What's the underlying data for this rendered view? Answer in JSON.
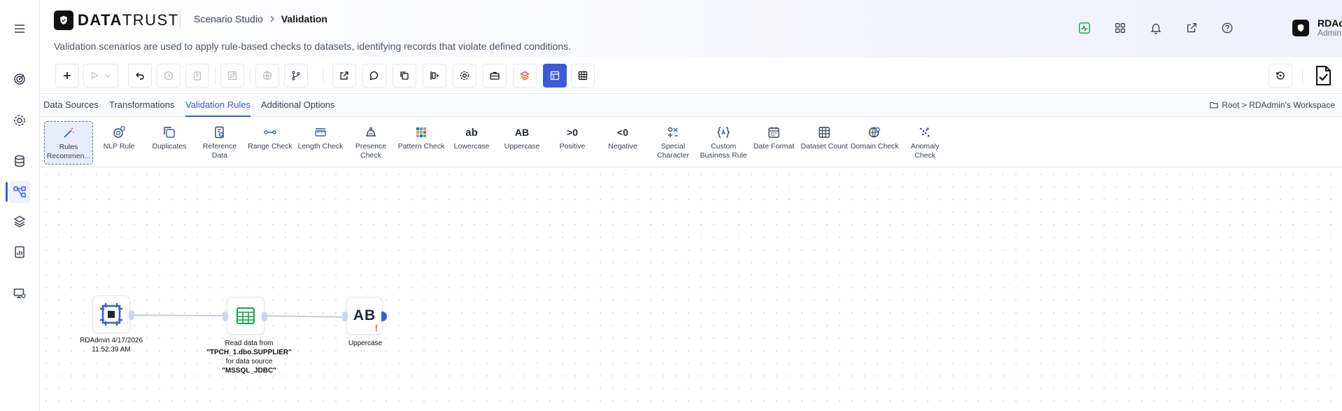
{
  "app": {
    "brand_prefix": "DATA",
    "brand_suffix": "TRUST",
    "breadcrumb": [
      "Scenario Studio",
      "Validation"
    ],
    "description": "Validation scenarios are used to apply rule-based checks to datasets, identifying records that violate defined conditions.",
    "accent_color": "#3b5bdb"
  },
  "user": {
    "name": "RDAdmin",
    "role": "Admin"
  },
  "tabs": [
    {
      "label": "Data Sources"
    },
    {
      "label": "Transformations"
    },
    {
      "label": "Validation Rules",
      "active": true
    },
    {
      "label": "Additional Options"
    }
  ],
  "workspace_path": "Root > RDAdmin's Workspace",
  "palette": [
    {
      "label": "Rules Recommen..."
    },
    {
      "label": "NLP Rule"
    },
    {
      "label": "Duplicates"
    },
    {
      "label": "Reference Data"
    },
    {
      "label": "Range Check"
    },
    {
      "label": "Length Check"
    },
    {
      "label": "Presence Check"
    },
    {
      "label": "Pattern Check"
    },
    {
      "label": "Lowercase",
      "glyph": "ab"
    },
    {
      "label": "Uppercase",
      "glyph": "AB"
    },
    {
      "label": "Positive",
      "glyph": ">0"
    },
    {
      "label": "Negative",
      "glyph": "<0"
    },
    {
      "label": "Special Character"
    },
    {
      "label": "Custom Business Rule"
    },
    {
      "label": "Date Format"
    },
    {
      "label": "Dataset Count"
    },
    {
      "label": "Domain Check"
    },
    {
      "label": "Anomaly Check"
    }
  ],
  "nodes": {
    "start": {
      "label": "RDAdmin 4/17/2026 11:52:39 AM"
    },
    "read": {
      "prefix": "Read data from ",
      "table": "\"TPCH_1.dbo.SUPPLIER\"",
      "mid": " for data source ",
      "source": "\"MSSQL_JDBC\""
    },
    "uppercase": {
      "label": "Uppercase",
      "glyph": "AB",
      "warning": "!"
    }
  }
}
